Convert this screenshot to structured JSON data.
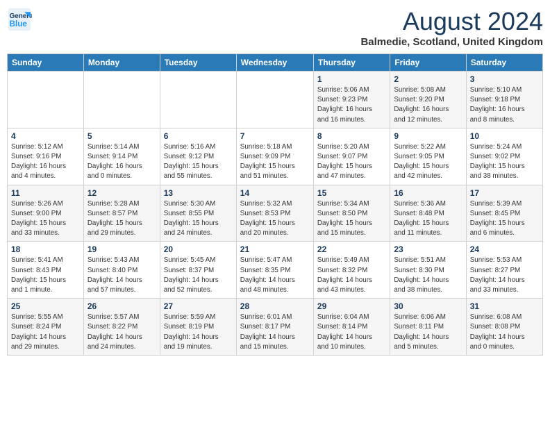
{
  "header": {
    "logo_line1": "General",
    "logo_line2": "Blue",
    "month": "August 2024",
    "location": "Balmedie, Scotland, United Kingdom"
  },
  "days_of_week": [
    "Sunday",
    "Monday",
    "Tuesday",
    "Wednesday",
    "Thursday",
    "Friday",
    "Saturday"
  ],
  "weeks": [
    {
      "row_class": "row-1",
      "days": [
        {
          "num": "",
          "info": ""
        },
        {
          "num": "",
          "info": ""
        },
        {
          "num": "",
          "info": ""
        },
        {
          "num": "",
          "info": ""
        },
        {
          "num": "1",
          "info": "Sunrise: 5:06 AM\nSunset: 9:23 PM\nDaylight: 16 hours\nand 16 minutes."
        },
        {
          "num": "2",
          "info": "Sunrise: 5:08 AM\nSunset: 9:20 PM\nDaylight: 16 hours\nand 12 minutes."
        },
        {
          "num": "3",
          "info": "Sunrise: 5:10 AM\nSunset: 9:18 PM\nDaylight: 16 hours\nand 8 minutes."
        }
      ]
    },
    {
      "row_class": "row-2",
      "days": [
        {
          "num": "4",
          "info": "Sunrise: 5:12 AM\nSunset: 9:16 PM\nDaylight: 16 hours\nand 4 minutes."
        },
        {
          "num": "5",
          "info": "Sunrise: 5:14 AM\nSunset: 9:14 PM\nDaylight: 16 hours\nand 0 minutes."
        },
        {
          "num": "6",
          "info": "Sunrise: 5:16 AM\nSunset: 9:12 PM\nDaylight: 15 hours\nand 55 minutes."
        },
        {
          "num": "7",
          "info": "Sunrise: 5:18 AM\nSunset: 9:09 PM\nDaylight: 15 hours\nand 51 minutes."
        },
        {
          "num": "8",
          "info": "Sunrise: 5:20 AM\nSunset: 9:07 PM\nDaylight: 15 hours\nand 47 minutes."
        },
        {
          "num": "9",
          "info": "Sunrise: 5:22 AM\nSunset: 9:05 PM\nDaylight: 15 hours\nand 42 minutes."
        },
        {
          "num": "10",
          "info": "Sunrise: 5:24 AM\nSunset: 9:02 PM\nDaylight: 15 hours\nand 38 minutes."
        }
      ]
    },
    {
      "row_class": "row-3",
      "days": [
        {
          "num": "11",
          "info": "Sunrise: 5:26 AM\nSunset: 9:00 PM\nDaylight: 15 hours\nand 33 minutes."
        },
        {
          "num": "12",
          "info": "Sunrise: 5:28 AM\nSunset: 8:57 PM\nDaylight: 15 hours\nand 29 minutes."
        },
        {
          "num": "13",
          "info": "Sunrise: 5:30 AM\nSunset: 8:55 PM\nDaylight: 15 hours\nand 24 minutes."
        },
        {
          "num": "14",
          "info": "Sunrise: 5:32 AM\nSunset: 8:53 PM\nDaylight: 15 hours\nand 20 minutes."
        },
        {
          "num": "15",
          "info": "Sunrise: 5:34 AM\nSunset: 8:50 PM\nDaylight: 15 hours\nand 15 minutes."
        },
        {
          "num": "16",
          "info": "Sunrise: 5:36 AM\nSunset: 8:48 PM\nDaylight: 15 hours\nand 11 minutes."
        },
        {
          "num": "17",
          "info": "Sunrise: 5:39 AM\nSunset: 8:45 PM\nDaylight: 15 hours\nand 6 minutes."
        }
      ]
    },
    {
      "row_class": "row-4",
      "days": [
        {
          "num": "18",
          "info": "Sunrise: 5:41 AM\nSunset: 8:43 PM\nDaylight: 15 hours\nand 1 minute."
        },
        {
          "num": "19",
          "info": "Sunrise: 5:43 AM\nSunset: 8:40 PM\nDaylight: 14 hours\nand 57 minutes."
        },
        {
          "num": "20",
          "info": "Sunrise: 5:45 AM\nSunset: 8:37 PM\nDaylight: 14 hours\nand 52 minutes."
        },
        {
          "num": "21",
          "info": "Sunrise: 5:47 AM\nSunset: 8:35 PM\nDaylight: 14 hours\nand 48 minutes."
        },
        {
          "num": "22",
          "info": "Sunrise: 5:49 AM\nSunset: 8:32 PM\nDaylight: 14 hours\nand 43 minutes."
        },
        {
          "num": "23",
          "info": "Sunrise: 5:51 AM\nSunset: 8:30 PM\nDaylight: 14 hours\nand 38 minutes."
        },
        {
          "num": "24",
          "info": "Sunrise: 5:53 AM\nSunset: 8:27 PM\nDaylight: 14 hours\nand 33 minutes."
        }
      ]
    },
    {
      "row_class": "row-5",
      "days": [
        {
          "num": "25",
          "info": "Sunrise: 5:55 AM\nSunset: 8:24 PM\nDaylight: 14 hours\nand 29 minutes."
        },
        {
          "num": "26",
          "info": "Sunrise: 5:57 AM\nSunset: 8:22 PM\nDaylight: 14 hours\nand 24 minutes."
        },
        {
          "num": "27",
          "info": "Sunrise: 5:59 AM\nSunset: 8:19 PM\nDaylight: 14 hours\nand 19 minutes."
        },
        {
          "num": "28",
          "info": "Sunrise: 6:01 AM\nSunset: 8:17 PM\nDaylight: 14 hours\nand 15 minutes."
        },
        {
          "num": "29",
          "info": "Sunrise: 6:04 AM\nSunset: 8:14 PM\nDaylight: 14 hours\nand 10 minutes."
        },
        {
          "num": "30",
          "info": "Sunrise: 6:06 AM\nSunset: 8:11 PM\nDaylight: 14 hours\nand 5 minutes."
        },
        {
          "num": "31",
          "info": "Sunrise: 6:08 AM\nSunset: 8:08 PM\nDaylight: 14 hours\nand 0 minutes."
        }
      ]
    }
  ]
}
